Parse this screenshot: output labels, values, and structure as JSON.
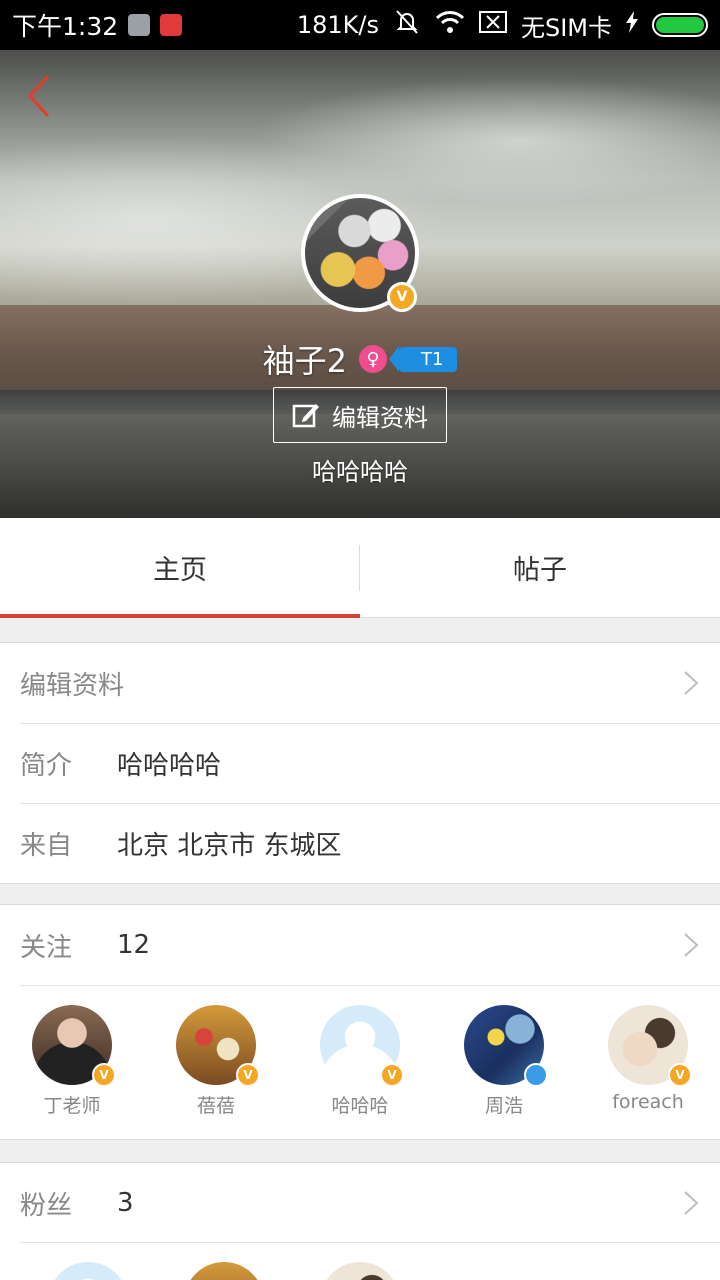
{
  "status_bar": {
    "time": "下午1:32",
    "net_speed": "181K/s",
    "sim": "无SIM卡",
    "icons": [
      "notification-icon",
      "app-icon",
      "mute-icon",
      "wifi-icon",
      "no-sim-icon",
      "charging-icon",
      "battery-icon"
    ],
    "battery_color": "#22c940"
  },
  "header": {
    "back_icon": "chevron-left-icon",
    "username": "袖子2",
    "gender_symbol": "♀",
    "level": "T1",
    "verified_mark": "V",
    "edit_button": "编辑资料",
    "bio": "哈哈哈哈"
  },
  "tabs": [
    {
      "label": "主页",
      "active": true
    },
    {
      "label": "帖子",
      "active": false
    }
  ],
  "profile": {
    "edit_label": "编辑资料",
    "intro_label": "简介",
    "intro_value": "哈哈哈哈",
    "from_label": "来自",
    "from_value": "北京 北京市 东城区"
  },
  "following": {
    "label": "关注",
    "count": "12",
    "users": [
      {
        "name": "丁老师",
        "badge": "V"
      },
      {
        "name": "蓓蓓",
        "badge": "V"
      },
      {
        "name": "哈哈哈",
        "badge": "V"
      },
      {
        "name": "周浩",
        "badge": "user-icon"
      },
      {
        "name": "foreach",
        "badge": "V"
      }
    ]
  },
  "fans": {
    "label": "粉丝",
    "count": "3"
  },
  "colors": {
    "accent": "#d8432f",
    "level_badge": "#1e8fe0",
    "gender_badge": "#ef4d8e",
    "verified_badge": "#f5a623"
  }
}
